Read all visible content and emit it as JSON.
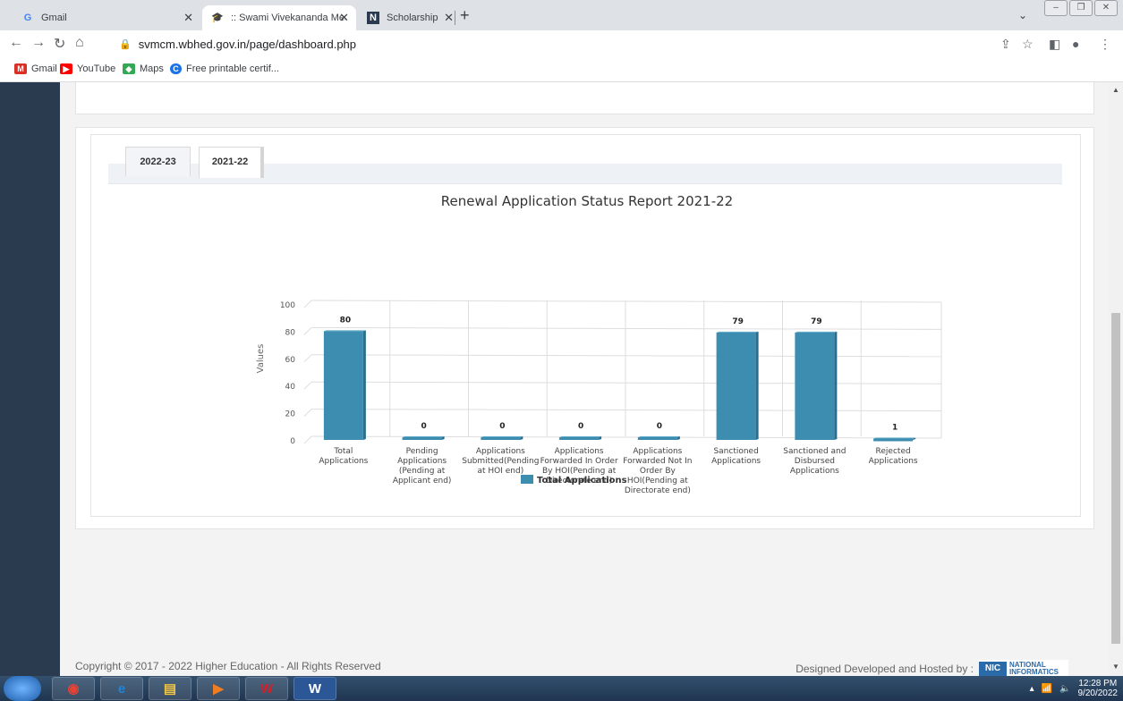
{
  "browser": {
    "tabs": [
      {
        "title": "Gmail",
        "icon": "google-icon"
      },
      {
        "title": ":: Swami Vivekananda Merit Cum",
        "icon": "mortarboard-icon"
      },
      {
        "title": "Scholarship",
        "icon": "scholarship-icon"
      }
    ],
    "url": "svmcm.wbhed.gov.in/page/dashboard.php",
    "bookmarks": [
      {
        "label": "Gmail",
        "icon": "gmail-icon",
        "color": "#d93025"
      },
      {
        "label": "YouTube",
        "icon": "youtube-icon",
        "color": "#ff0000"
      },
      {
        "label": "Maps",
        "icon": "maps-icon",
        "color": "#34a853"
      },
      {
        "label": "Free printable certif...",
        "icon": "certif-icon",
        "color": "#1a73e8"
      }
    ]
  },
  "page": {
    "year_tabs": [
      {
        "label": "2022-23",
        "active": false
      },
      {
        "label": "2021-22",
        "active": true
      }
    ],
    "footer_left": "Copyright © 2017 - 2022 Higher Education - All Rights Reserved",
    "footer_right": "Designed Developed and Hosted by :",
    "nic_logo_text": "NATIONAL INFORMATICS"
  },
  "chart_data": {
    "type": "bar",
    "title": "Renewal Application Status Report 2021-22",
    "ylabel": "Values",
    "xlabel": "",
    "ylim": [
      0,
      100
    ],
    "yticks": [
      0,
      20,
      40,
      60,
      80,
      100
    ],
    "grid": true,
    "legend_position": "bottom",
    "bar_color": "#3d8db0",
    "categories": [
      "Total Applications",
      "Pending Applications (Pending at Applicant end)",
      "Applications Submitted(Pending at HOI end)",
      "Applications Forwarded In Order By HOI(Pending at Directorate end)",
      "Applications Forwarded Not In Order By HOI(Pending at Directorate end)",
      "Sanctioned Applications",
      "Sanctioned and Disbursed Applications",
      "Rejected Applications"
    ],
    "category_lines": [
      [
        "Total",
        "Applications"
      ],
      [
        "Pending",
        "Applications",
        "(Pending at",
        "Applicant end)"
      ],
      [
        "Applications",
        "Submitted(Pending",
        "at HOI end)"
      ],
      [
        "Applications",
        "Forwarded In Order",
        "By HOI(Pending at",
        "Directorate end)"
      ],
      [
        "Applications",
        "Forwarded Not In",
        "Order By",
        "HOI(Pending at",
        "Directorate end)"
      ],
      [
        "Sanctioned",
        "Applications"
      ],
      [
        "Sanctioned and",
        "Disbursed",
        "Applications"
      ],
      [
        "Rejected",
        "Applications"
      ]
    ],
    "series": [
      {
        "name": "Total Applications",
        "values": [
          80,
          0,
          0,
          0,
          0,
          79,
          79,
          1
        ]
      }
    ]
  },
  "taskbar": {
    "time": "12:28 PM",
    "date": "9/20/2022",
    "apps": [
      {
        "icon": "chrome-icon",
        "color": "#e94235"
      },
      {
        "icon": "internet-explorer-icon",
        "color": "#1f86d6"
      },
      {
        "icon": "file-explorer-icon",
        "color": "#f4c542"
      },
      {
        "icon": "media-player-icon",
        "color": "#f07d22"
      },
      {
        "icon": "wps-office-icon",
        "color": "#d0212a"
      },
      {
        "icon": "word-icon",
        "color": "#2b5797"
      }
    ]
  }
}
